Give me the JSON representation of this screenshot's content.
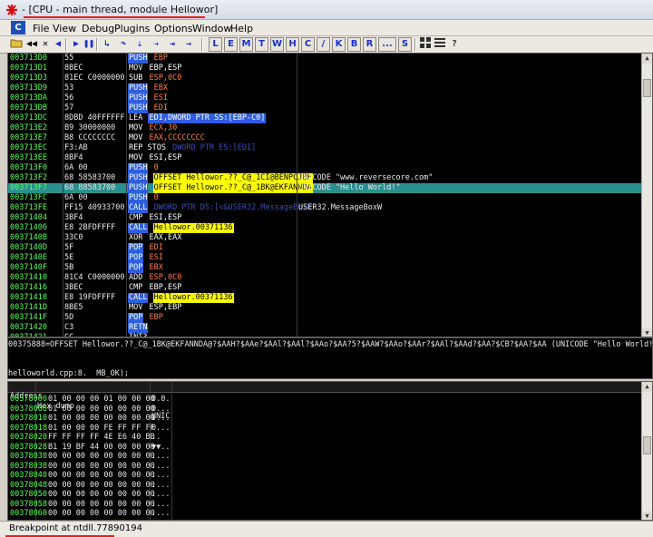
{
  "window": {
    "title": "- [CPU - main thread, module Hellowor]"
  },
  "menubar": {
    "c_label": "C",
    "items": [
      "File",
      "View",
      "Debug",
      "Plugins",
      "Options",
      "Window",
      "Help"
    ]
  },
  "toolbar": {
    "letters": [
      "L",
      "E",
      "M",
      "T",
      "W",
      "H",
      "C",
      "/",
      "K",
      "B",
      "R",
      "...",
      "S"
    ]
  },
  "colors": {
    "background": "#000000",
    "address": "#5cff5c",
    "text": "#e8e8e8",
    "highlight_row": "#2a8f8f",
    "keyword_blue": "#2f5fe0",
    "label_yellow": "#ffff00",
    "string_comment": "#e8e8e8",
    "register_orange": "#ff8040",
    "dark_blue_text": "#3c4fb4",
    "window_chrome": "#ece9e2",
    "annotation_red": "#e02020"
  },
  "disasm": {
    "rows": [
      {
        "addr": "003713D0",
        "hex": "55",
        "op": "PUSH",
        "args": "EBP",
        "comment": ""
      },
      {
        "addr": "003713D1",
        "hex": "8BEC",
        "op": "MOV",
        "args": "EBP,ESP",
        "comment": ""
      },
      {
        "addr": "003713D3",
        "hex": "81EC C0000000",
        "op": "SUB",
        "args": "ESP,0C0",
        "comment": ""
      },
      {
        "addr": "003713D9",
        "hex": "53",
        "op": "PUSH",
        "args": "EBX",
        "comment": ""
      },
      {
        "addr": "003713DA",
        "hex": "56",
        "op": "PUSH",
        "args": "ESI",
        "comment": ""
      },
      {
        "addr": "003713DB",
        "hex": "57",
        "op": "PUSH",
        "args": "EDI",
        "comment": ""
      },
      {
        "addr": "003713DC",
        "hex": "8DBD 40FFFFFF",
        "op": "LEA",
        "args": "EDI,DWORD PTR SS:[EBP-C0]",
        "comment": ""
      },
      {
        "addr": "003713E2",
        "hex": "B9 30000000",
        "op": "MOV",
        "args": "ECX,30",
        "comment": ""
      },
      {
        "addr": "003713E7",
        "hex": "B8 CCCCCCCC",
        "op": "MOV",
        "args": "EAX,CCCCCCCC",
        "comment": ""
      },
      {
        "addr": "003713EC",
        "hex": "F3:AB",
        "op": "REP STOS",
        "args": "DWORD PTR ES:[EDI]",
        "comment": ""
      },
      {
        "addr": "003713EE",
        "hex": "8BF4",
        "op": "MOV",
        "args": "ESI,ESP",
        "comment": ""
      },
      {
        "addr": "003713F0",
        "hex": "6A 00",
        "op": "PUSH",
        "args": "0",
        "comment": ""
      },
      {
        "addr": "003713F2",
        "hex": "68 58583700",
        "op": "PUSH",
        "args": "OFFSET Hellowor.??_C@_1CI@BENPCJBF",
        "comment": "UNICODE \"www.reversecore.com\""
      },
      {
        "addr": "003713F7",
        "hex": "68 88583700",
        "op": "PUSH",
        "args": "OFFSET Hellowor.??_C@_1BK@EKFANNDA",
        "comment": "UNICODE \"Hello World!\""
      },
      {
        "addr": "003713FC",
        "hex": "6A 00",
        "op": "PUSH",
        "args": "0",
        "comment": ""
      },
      {
        "addr": "003713FE",
        "hex": "FF15 40933700",
        "op": "CALL",
        "args": "DWORD PTR DS:[<&USER32.MessageBoxW",
        "comment": "USER32.MessageBoxW"
      },
      {
        "addr": "00371404",
        "hex": "3BF4",
        "op": "CMP",
        "args": "ESI,ESP",
        "comment": ""
      },
      {
        "addr": "00371406",
        "hex": "E8 2BFDFFFF",
        "op": "CALL",
        "args": "Hellowor.00371136",
        "comment": ""
      },
      {
        "addr": "0037140B",
        "hex": "33C0",
        "op": "XOR",
        "args": "EAX,EAX",
        "comment": ""
      },
      {
        "addr": "0037140D",
        "hex": "5F",
        "op": "POP",
        "args": "EDI",
        "comment": ""
      },
      {
        "addr": "0037140E",
        "hex": "5E",
        "op": "POP",
        "args": "ESI",
        "comment": ""
      },
      {
        "addr": "0037140F",
        "hex": "5B",
        "op": "POP",
        "args": "EBX",
        "comment": ""
      },
      {
        "addr": "00371410",
        "hex": "81C4 C0000000",
        "op": "ADD",
        "args": "ESP,0C0",
        "comment": ""
      },
      {
        "addr": "00371416",
        "hex": "3BEC",
        "op": "CMP",
        "args": "EBP,ESP",
        "comment": ""
      },
      {
        "addr": "00371418",
        "hex": "E8 19FDFFFF",
        "op": "CALL",
        "args": "Hellowor.00371136",
        "comment": ""
      },
      {
        "addr": "0037141D",
        "hex": "8BE5",
        "op": "MOV",
        "args": "ESP,EBP",
        "comment": ""
      },
      {
        "addr": "0037141F",
        "hex": "5D",
        "op": "POP",
        "args": "EBP",
        "comment": ""
      },
      {
        "addr": "00371420",
        "hex": "C3",
        "op": "RETN",
        "args": "",
        "comment": ""
      },
      {
        "addr": "00371421",
        "hex": "CC",
        "op": "INT3",
        "args": "",
        "comment": ""
      }
    ],
    "selected_index": 13
  },
  "info_pane": {
    "line1": "00375888=OFFSET Hellowor.??_C@_1BK@EKFANNDA@?$AAH?$AAe?$AAl?$AAl?$AAo?$AA?5?$AAW?$AAo?$AAr?$AAl?$AAd?$AA?$CB?$AA?$AA (UNICODE \"Hello World!\")",
    "line2": "helloworld.cpp:8.  MB_OK);"
  },
  "dump": {
    "headers": [
      "Address",
      "Hex dump",
      "UNIC"
    ],
    "rows": [
      {
        "addr": "00378000",
        "hex": "01 00 00 00 01 00 00 00",
        "text": "0.0."
      },
      {
        "addr": "00378008",
        "hex": "01 00 00 00 00 00 00 00",
        "text": "0..."
      },
      {
        "addr": "00378010",
        "hex": "01 00 00 00 00 00 00 00",
        "text": "0..."
      },
      {
        "addr": "00378018",
        "hex": "01 00 00 00 FE FF FF FF",
        "text": "0..."
      },
      {
        "addr": "00378020",
        "hex": "FF FF FF FF 4E E6 40 BB",
        "text": "..  "
      },
      {
        "addr": "00378028",
        "hex": "B1 19 BF 44 00 00 00 00",
        "text": "▼▼.."
      },
      {
        "addr": "00378030",
        "hex": "00 00 00 00 00 00 00 00",
        "text": "...."
      },
      {
        "addr": "00378038",
        "hex": "00 00 00 00 00 00 00 00",
        "text": "...."
      },
      {
        "addr": "00378040",
        "hex": "00 00 00 00 00 00 00 00",
        "text": "...."
      },
      {
        "addr": "00378048",
        "hex": "00 00 00 00 00 00 00 00",
        "text": "...."
      },
      {
        "addr": "00378050",
        "hex": "00 00 00 00 00 00 00 00",
        "text": "...."
      },
      {
        "addr": "00378058",
        "hex": "00 00 00 00 00 00 00 00",
        "text": "...."
      },
      {
        "addr": "00378060",
        "hex": "00 00 00 00 00 00 00 00",
        "text": "...."
      }
    ]
  },
  "status": {
    "text": "Breakpoint at ntdll.77890194"
  }
}
